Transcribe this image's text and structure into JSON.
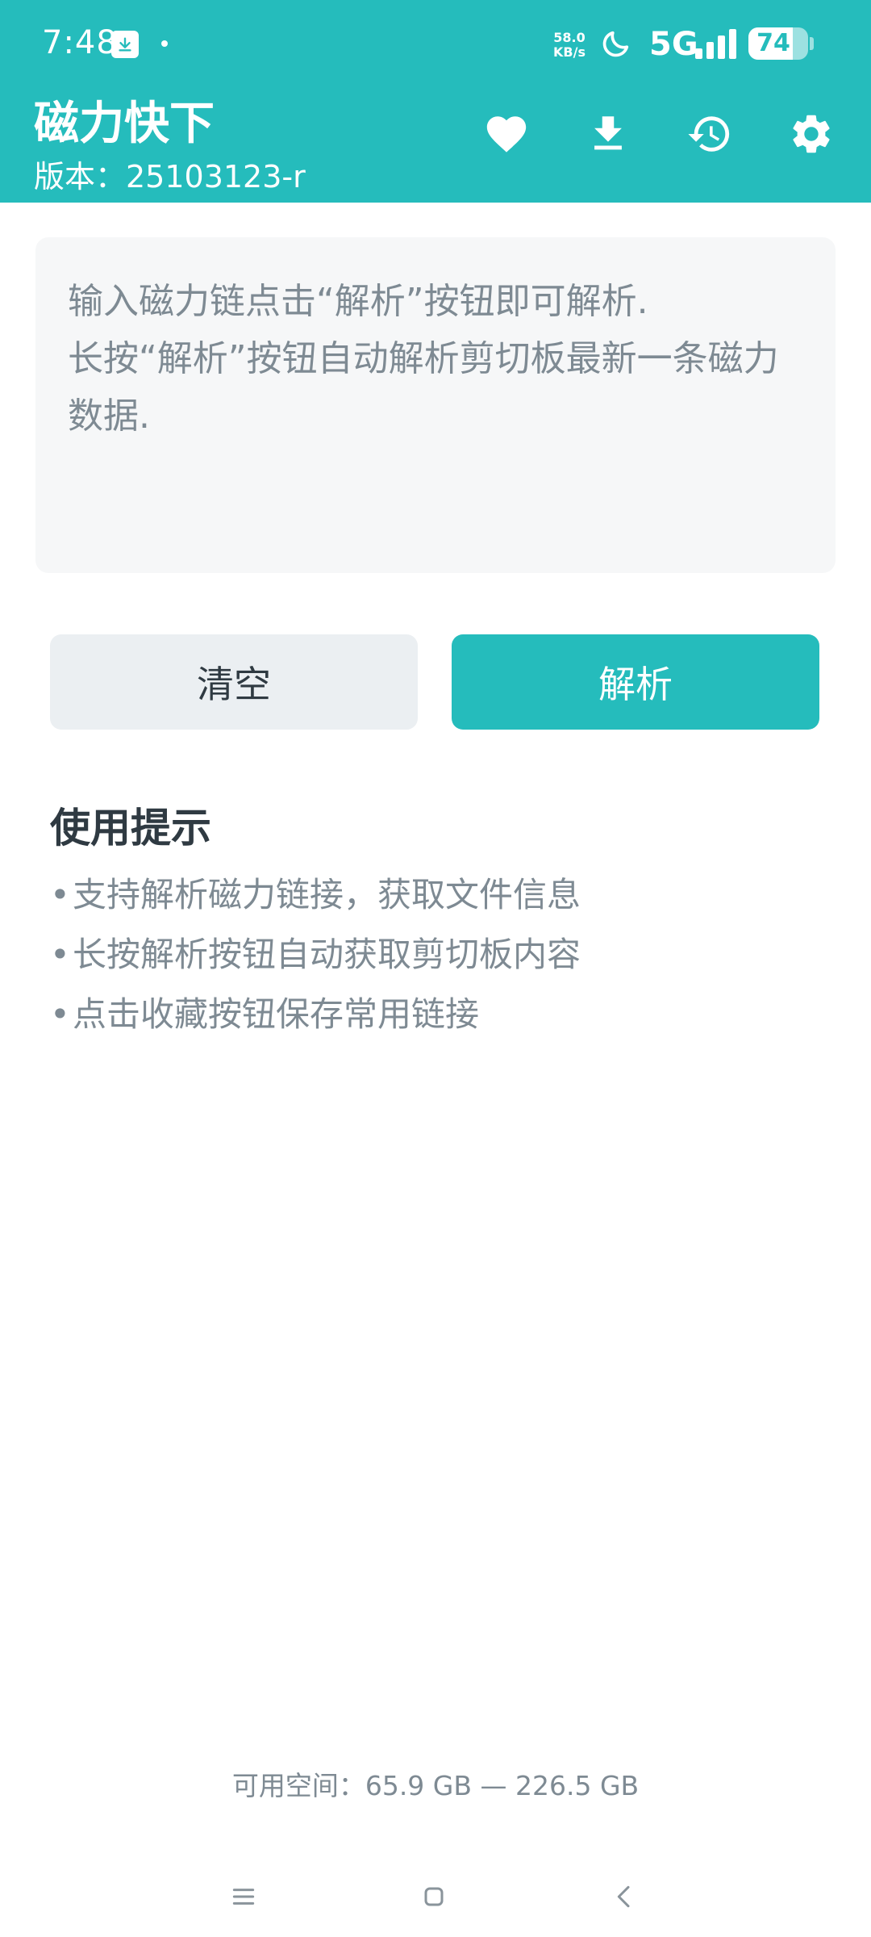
{
  "status_bar": {
    "time": "7:48",
    "net_speed_value": "58.0",
    "net_speed_unit": "KB/s",
    "network": "5G",
    "battery": "74",
    "battery_level": 0.74
  },
  "app_bar": {
    "title": "磁力快下",
    "version": "版本：25103123-r",
    "actions": [
      "heart-icon",
      "download-icon",
      "history-icon",
      "gear-icon"
    ]
  },
  "input": {
    "value": "",
    "placeholder": "输入磁力链点击“解析”按钮即可解析.\n长按“解析”按钮自动解析剪切板最新一条磁力数据."
  },
  "buttons": {
    "clear_label": "清空",
    "parse_label": "解析"
  },
  "tips": {
    "title": "使用提示",
    "bullet": "•",
    "items": [
      "支持解析磁力链接，获取文件信息",
      "长按解析按钮自动获取剪切板内容",
      "点击收藏按钮保存常用链接"
    ]
  },
  "footer": {
    "storage": "可用空间：65.9 GB — 226.5 GB"
  },
  "colors": {
    "accent": "#25BCBC",
    "text_dark": "#2F3A42",
    "text_muted": "#7E8A93",
    "input_bg": "#F6F7F8",
    "clear_button_bg": "#EBEFF2"
  }
}
